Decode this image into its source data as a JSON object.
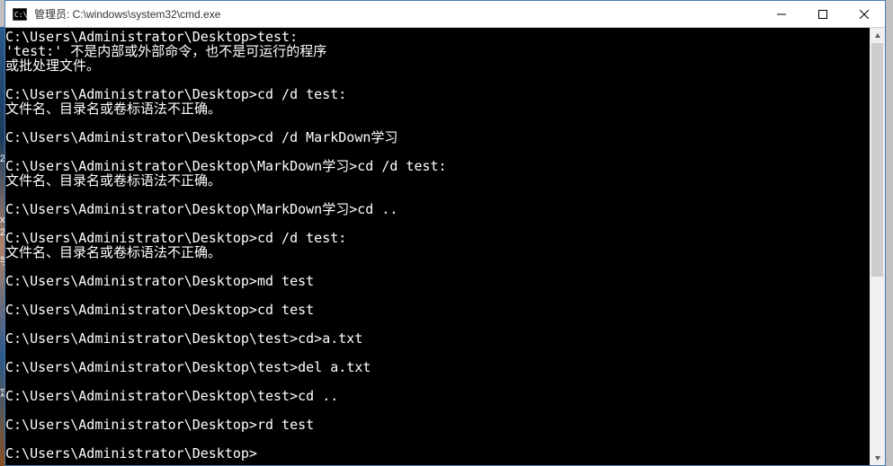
{
  "window": {
    "title": "管理员: C:\\windows\\system32\\cmd.exe"
  },
  "terminal": {
    "lines": [
      "C:\\Users\\Administrator\\Desktop>test:",
      "'test:' 不是内部或外部命令，也不是可运行的程序",
      "或批处理文件。",
      "",
      "C:\\Users\\Administrator\\Desktop>cd /d test:",
      "文件名、目录名或卷标语法不正确。",
      "",
      "C:\\Users\\Administrator\\Desktop>cd /d MarkDown学习",
      "",
      "C:\\Users\\Administrator\\Desktop\\MarkDown学习>cd /d test:",
      "文件名、目录名或卷标语法不正确。",
      "",
      "C:\\Users\\Administrator\\Desktop\\MarkDown学习>cd ..",
      "",
      "C:\\Users\\Administrator\\Desktop>cd /d test:",
      "文件名、目录名或卷标语法不正确。",
      "",
      "C:\\Users\\Administrator\\Desktop>md test",
      "",
      "C:\\Users\\Administrator\\Desktop>cd test",
      "",
      "C:\\Users\\Administrator\\Desktop\\test>cd>a.txt",
      "",
      "C:\\Users\\Administrator\\Desktop\\test>del a.txt",
      "",
      "C:\\Users\\Administrator\\Desktop\\test>cd ..",
      "",
      "C:\\Users\\Administrator\\Desktop>rd test",
      "",
      "C:\\Users\\Administrator\\Desktop>"
    ]
  },
  "sliver": {
    "chars": [
      "2",
      "x",
      "2",
      "学",
      "定"
    ],
    "positions": [
      171,
      239,
      253,
      282,
      429
    ]
  }
}
